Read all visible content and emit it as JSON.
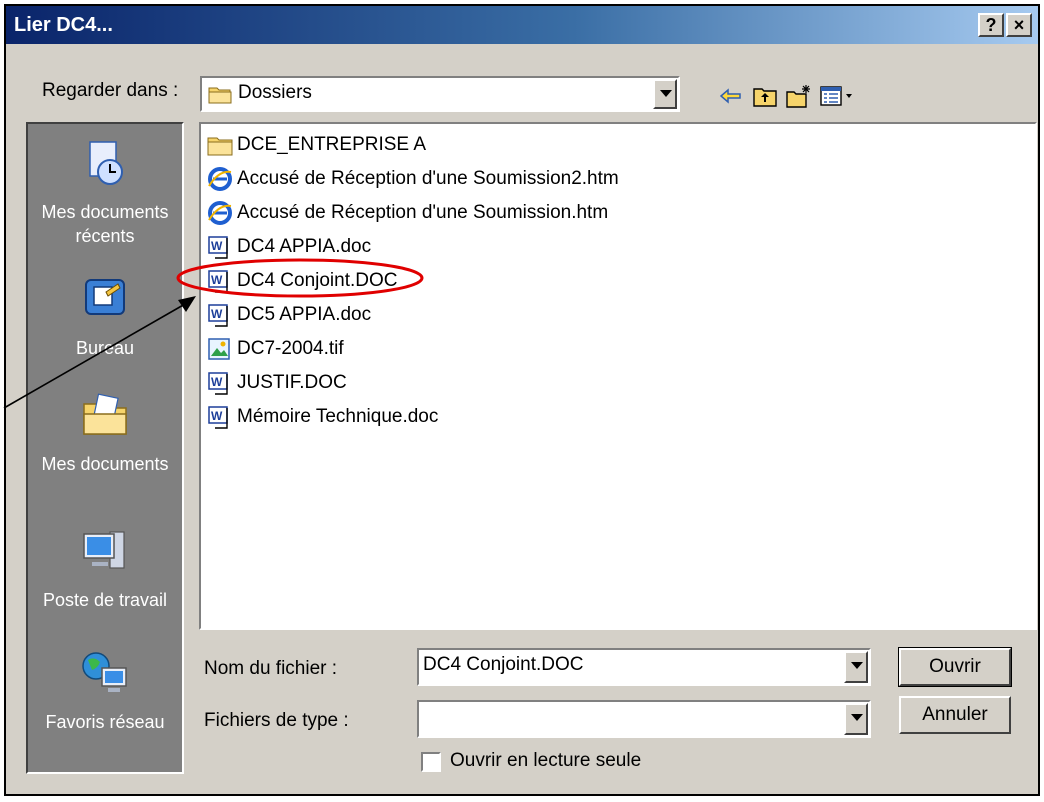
{
  "window": {
    "title": "Lier DC4...",
    "help_button": "?",
    "close_button": "×"
  },
  "look_in": {
    "label": "Regarder dans :",
    "value": "Dossiers"
  },
  "toolbar": {
    "icons": [
      "back-arrow-icon",
      "up-folder-icon",
      "new-folder-icon",
      "view-menu-icon"
    ]
  },
  "places": [
    {
      "label": "Mes documents récents",
      "icon": "recent-documents-icon"
    },
    {
      "label": "Bureau",
      "icon": "desktop-icon"
    },
    {
      "label": "Mes documents",
      "icon": "my-documents-icon"
    },
    {
      "label": "Poste de travail",
      "icon": "my-computer-icon"
    },
    {
      "label": "Favoris réseau",
      "icon": "network-places-icon"
    }
  ],
  "files": [
    {
      "name": "DCE_ENTREPRISE A",
      "type": "folder"
    },
    {
      "name": "Accusé de Réception d'une Soumission2.htm",
      "type": "html"
    },
    {
      "name": "Accusé de Réception d'une Soumission.htm",
      "type": "html"
    },
    {
      "name": "DC4 APPIA.doc",
      "type": "word"
    },
    {
      "name": "DC4 Conjoint.DOC",
      "type": "word",
      "highlighted": true
    },
    {
      "name": "DC5 APPIA.doc",
      "type": "word"
    },
    {
      "name": "DC7-2004.tif",
      "type": "image"
    },
    {
      "name": "JUSTIF.DOC",
      "type": "word"
    },
    {
      "name": "Mémoire Technique.doc",
      "type": "word"
    }
  ],
  "filename": {
    "label": "Nom du fichier :",
    "value": "DC4 Conjoint.DOC"
  },
  "filetype": {
    "label": "Fichiers de type :",
    "value": ""
  },
  "buttons": {
    "open": "Ouvrir",
    "cancel": "Annuler"
  },
  "readonly_checkbox": {
    "label": "Ouvrir en lecture seule",
    "checked": false
  },
  "annotation": {
    "highlight_color": "#e00000",
    "arrow_color": "#000000"
  },
  "colors": {
    "titlebar_start": "#0a246a",
    "titlebar_end": "#a6caf0",
    "dialog_face": "#d4d0c8",
    "places_bar": "#808080"
  }
}
